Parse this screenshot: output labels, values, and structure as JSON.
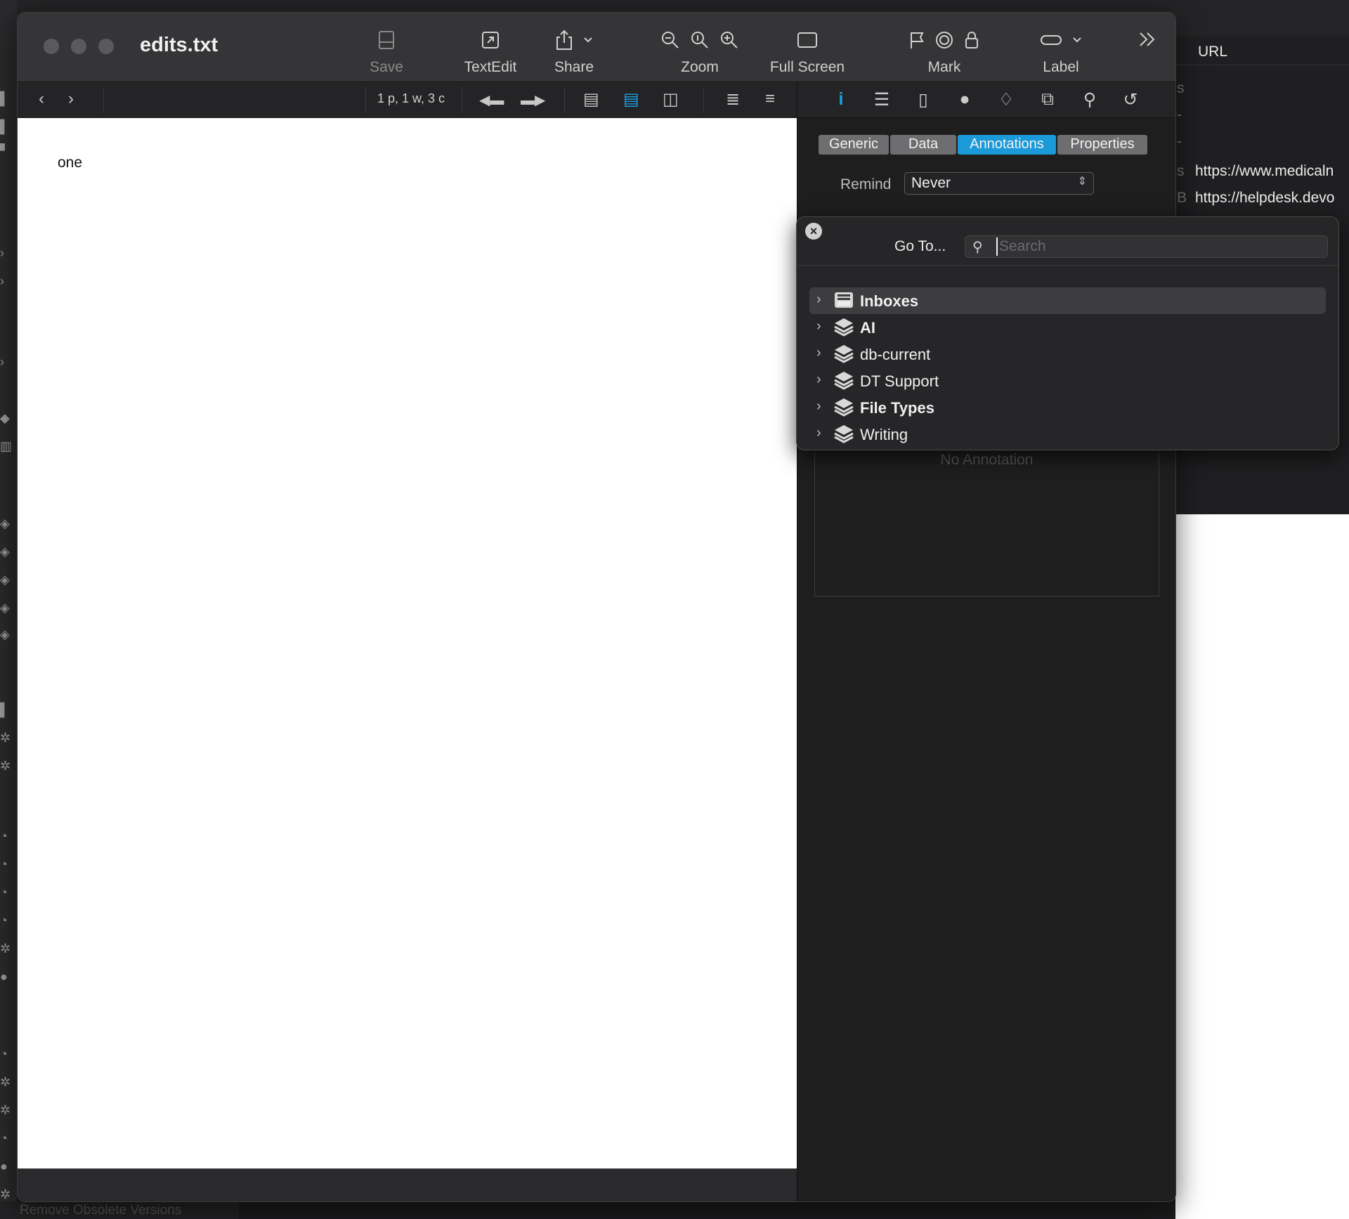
{
  "background": {
    "right_header": "URL",
    "right_rows": [
      {
        "key": "s",
        "value": ""
      },
      {
        "key": "-",
        "value": ""
      },
      {
        "key": "-",
        "value": ""
      },
      {
        "key": "s",
        "value": "https://www.medicaln"
      },
      {
        "key": "B",
        "value": "https://helpdesk.devo"
      }
    ],
    "bottom_text": "Remove Obsolete Versions"
  },
  "window": {
    "title": "edits.txt",
    "toolbar": [
      {
        "label": "Save",
        "icon": "save-icon",
        "enabled": false
      },
      {
        "label": "TextEdit",
        "icon": "open-external-icon",
        "enabled": true
      },
      {
        "label": "Share",
        "icon": "share-icon",
        "enabled": true
      },
      {
        "label": "Zoom",
        "icon": "zoom-icons",
        "enabled": true
      },
      {
        "label": "Full Screen",
        "icon": "full-screen-icon",
        "enabled": true
      },
      {
        "label": "Mark",
        "icon": "flag-icon",
        "enabled": true
      },
      {
        "label": "Label",
        "icon": "label-icon",
        "enabled": true
      }
    ],
    "doc_stats": "1 p, 1 w, 3 c",
    "document_text": "one"
  },
  "inspector": {
    "tabs": [
      {
        "label": "Generic",
        "active": false
      },
      {
        "label": "Data",
        "active": false
      },
      {
        "label": "Annotations",
        "active": true
      },
      {
        "label": "Properties",
        "active": false
      }
    ],
    "remind_label": "Remind",
    "remind_value": "Never",
    "annotation_placeholder": "No Annotation"
  },
  "goto": {
    "label": "Go To...",
    "search_placeholder": "Search",
    "items": [
      {
        "name": "Inboxes",
        "icon": "inbox-icon",
        "bold": true,
        "selected": true
      },
      {
        "name": "AI",
        "icon": "database-icon",
        "bold": true,
        "selected": false
      },
      {
        "name": "db-current",
        "icon": "database-icon",
        "bold": false,
        "selected": false
      },
      {
        "name": "DT Support",
        "icon": "database-icon",
        "bold": false,
        "selected": false
      },
      {
        "name": "File Types",
        "icon": "database-icon",
        "bold": true,
        "selected": false
      },
      {
        "name": "Writing",
        "icon": "database-icon",
        "bold": false,
        "selected": false
      }
    ]
  },
  "colors": {
    "accent": "#1a9ad9",
    "window_bg": "#1e1e1e",
    "titlebar": "#353537",
    "document_bg": "#ffffff"
  }
}
